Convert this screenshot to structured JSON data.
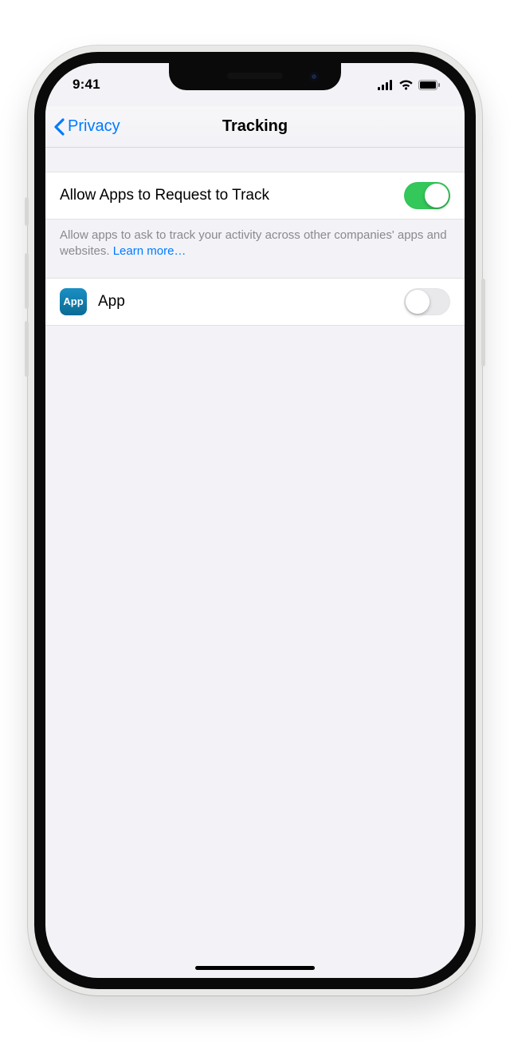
{
  "status": {
    "time": "9:41"
  },
  "nav": {
    "back_label": "Privacy",
    "title": "Tracking"
  },
  "settings": {
    "allow_label": "Allow Apps to Request to Track",
    "allow_enabled": true,
    "footer_text": "Allow apps to ask to track your activity across other companies' apps and websites. ",
    "learn_more": "Learn more…",
    "app_row": {
      "icon_text": "App",
      "label": "App",
      "enabled": false
    }
  },
  "colors": {
    "accent": "#007aff",
    "toggle_on": "#34c759"
  }
}
